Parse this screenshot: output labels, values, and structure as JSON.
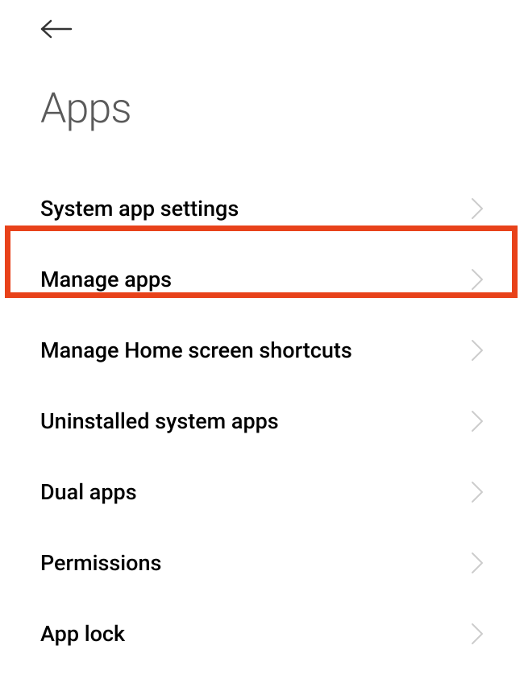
{
  "header": {
    "title": "Apps"
  },
  "list": {
    "items": [
      {
        "label": "System app settings"
      },
      {
        "label": "Manage apps"
      },
      {
        "label": "Manage Home screen shortcuts"
      },
      {
        "label": "Uninstalled system apps"
      },
      {
        "label": "Dual apps"
      },
      {
        "label": "Permissions"
      },
      {
        "label": "App lock"
      }
    ]
  },
  "highlighted_index": 1
}
